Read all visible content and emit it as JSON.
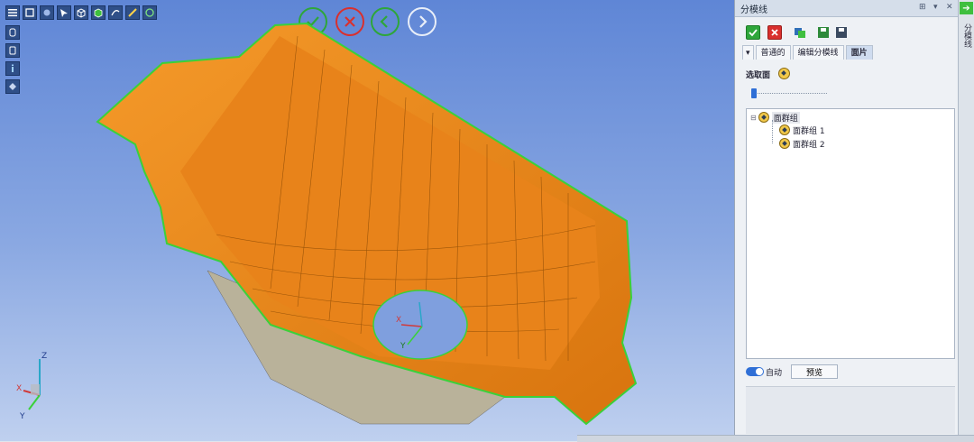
{
  "viewport": {
    "toolbar_icons": [
      "menu-icon",
      "fit-view-icon",
      "light-icon",
      "select-icon",
      "wireframe-cube-icon",
      "shaded-cube-icon",
      "curve-icon",
      "measure-icon",
      "snapshot-icon"
    ],
    "left_toolbar_icons": [
      "cylinder-icon",
      "cylinder-outline-icon",
      "info-icon",
      "view-settings-icon"
    ],
    "nav_buttons": [
      "confirm-icon",
      "cancel-icon",
      "previous-icon",
      "next-icon"
    ],
    "hole_axis": {
      "x_label": "X",
      "y_label": "Y"
    },
    "triad": {
      "z_label": "Z",
      "x_label": "X",
      "y_label": "Y"
    }
  },
  "panel": {
    "title": "分模线",
    "title_controls": [
      "pin-icon",
      "dropdown-icon",
      "close-icon"
    ],
    "toolbar_icons": [
      "check-icon",
      "close-red-icon",
      "swap-icon",
      "save-green-icon",
      "save-icon"
    ],
    "tabs": [
      "普通的",
      "编辑分模线",
      "面片"
    ],
    "active_tab": "面片",
    "select_face_label": "选取面",
    "tree": {
      "root": "面群组",
      "children": [
        "面群组 1",
        "面群组 2"
      ]
    },
    "auto_label": "自动",
    "preview_label": "预览"
  },
  "sidebar": {
    "label": "分模线"
  }
}
